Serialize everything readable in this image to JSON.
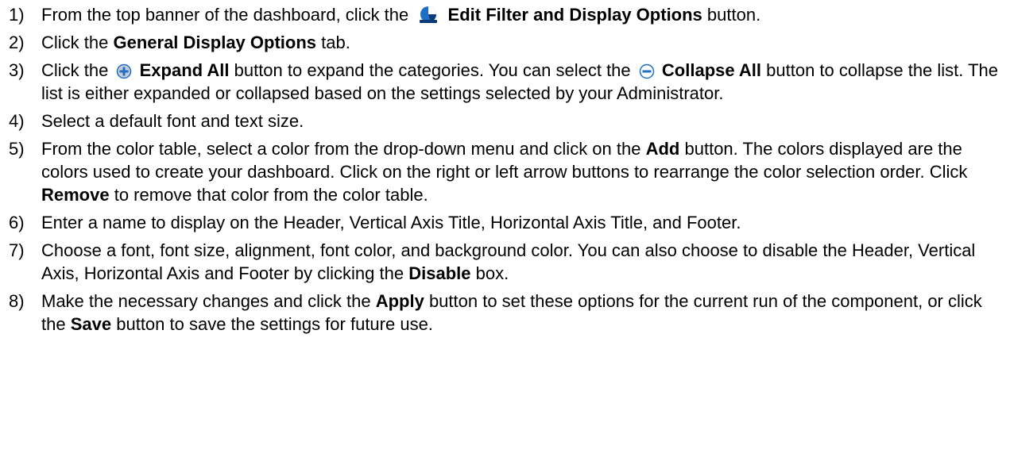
{
  "steps": [
    {
      "number": "1)",
      "pre": "From the top banner of the dashboard, click the",
      "icon": "edit-filter-display-icon",
      "bold": "Edit Filter and Display Options",
      "post": "button."
    },
    {
      "number": "2)",
      "pre": "Click the",
      "bold": "General Display Options",
      "post": "tab."
    },
    {
      "number": "3)",
      "pre": "Click the",
      "icon": "expand-all-icon",
      "bold": "Expand All",
      "mid": "button to expand the categories. You can select the",
      "icon2": "collapse-all-icon",
      "bold2": "Collapse All",
      "post": "button to collapse the list. The list is either expanded or collapsed based on the settings selected by your Administrator."
    },
    {
      "number": "4)",
      "text": "Select a default font and text size."
    },
    {
      "number": "5)",
      "pre": "From the color table, select a color from the drop-down menu and click on the",
      "bold": "Add",
      "mid": "button. The colors displayed are the colors used to create your dashboard. Click on the right or left arrow buttons to rearrange the color selection order. Click",
      "bold2": "Remove",
      "post": "to remove that color from the color table."
    },
    {
      "number": "6)",
      "text": "Enter a name to display on the Header, Vertical Axis Title, Horizontal Axis Title, and Footer."
    },
    {
      "number": "7)",
      "pre": "Choose a font, font size, alignment, font color, and background color. You can also choose to disable the Header, Vertical Axis, Horizontal Axis and Footer by clicking the",
      "bold": "Disable",
      "post": "box."
    },
    {
      "number": "8)",
      "pre": "Make the necessary changes and click the",
      "bold": "Apply",
      "mid": "button to set these options for the current run of the component, or click the",
      "bold2": "Save",
      "post": "button to save the settings for future use."
    }
  ],
  "colors": {
    "icon_blue": "#1f6fc4",
    "icon_dark": "#0b3a78",
    "icon_gray": "#c8ccd4"
  }
}
